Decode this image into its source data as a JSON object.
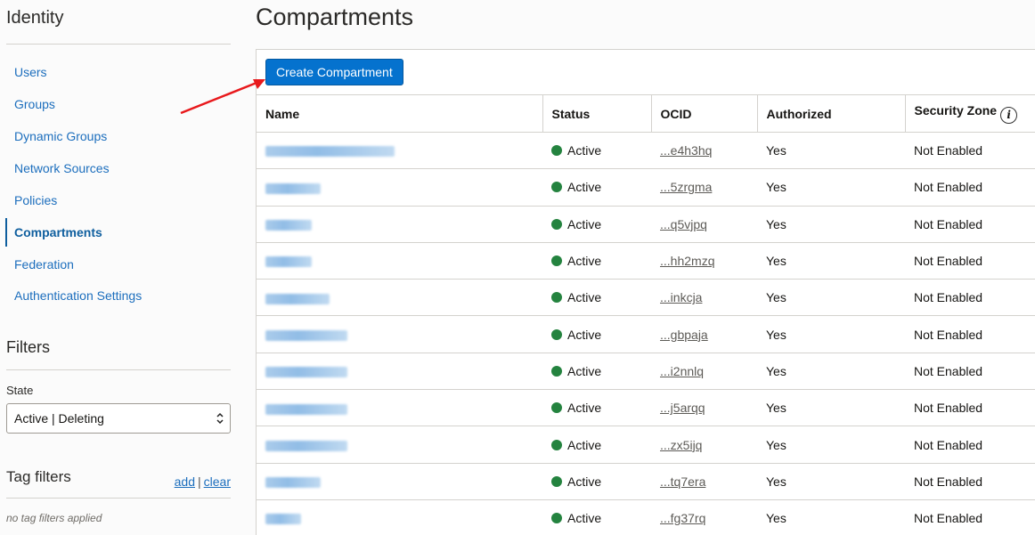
{
  "sidebar": {
    "title": "Identity",
    "nav": [
      {
        "label": "Users"
      },
      {
        "label": "Groups"
      },
      {
        "label": "Dynamic Groups"
      },
      {
        "label": "Network Sources"
      },
      {
        "label": "Policies"
      },
      {
        "label": "Compartments",
        "active": true
      },
      {
        "label": "Federation"
      },
      {
        "label": "Authentication Settings"
      }
    ],
    "filters_title": "Filters",
    "state_label": "State",
    "state_value": "Active | Deleting",
    "tag_filters_title": "Tag filters",
    "tag_add": "add",
    "tag_sep": "|",
    "tag_clear": "clear",
    "no_tag_filters": "no tag filters applied"
  },
  "main": {
    "title": "Compartments",
    "create_button": "Create Compartment",
    "columns": [
      "Name",
      "Status",
      "OCID",
      "Authorized",
      "Security Zone"
    ],
    "rows": [
      {
        "status": "Active",
        "ocid": "...e4h3hq",
        "authorized": "Yes",
        "security_zone": "Not Enabled"
      },
      {
        "status": "Active",
        "ocid": "...5zrgma",
        "authorized": "Yes",
        "security_zone": "Not Enabled"
      },
      {
        "status": "Active",
        "ocid": "...q5vjpq",
        "authorized": "Yes",
        "security_zone": "Not Enabled"
      },
      {
        "status": "Active",
        "ocid": "...hh2mzq",
        "authorized": "Yes",
        "security_zone": "Not Enabled"
      },
      {
        "status": "Active",
        "ocid": "...inkcja",
        "authorized": "Yes",
        "security_zone": "Not Enabled"
      },
      {
        "status": "Active",
        "ocid": "...gbpaja",
        "authorized": "Yes",
        "security_zone": "Not Enabled"
      },
      {
        "status": "Active",
        "ocid": "...i2nnlq",
        "authorized": "Yes",
        "security_zone": "Not Enabled"
      },
      {
        "status": "Active",
        "ocid": "...j5arqq",
        "authorized": "Yes",
        "security_zone": "Not Enabled"
      },
      {
        "status": "Active",
        "ocid": "...zx5ijq",
        "authorized": "Yes",
        "security_zone": "Not Enabled"
      },
      {
        "status": "Active",
        "ocid": "...tq7era",
        "authorized": "Yes",
        "security_zone": "Not Enabled"
      },
      {
        "status": "Active",
        "ocid": "...fg37rq",
        "authorized": "Yes",
        "security_zone": "Not Enabled"
      }
    ]
  },
  "colors": {
    "accent": "#0572ce",
    "link": "#1c6ebd",
    "status_active": "#24833f",
    "annotation_arrow": "#e8191c"
  },
  "icons": {
    "info": "info-icon",
    "select_chevrons": "chevron-up-down-icon",
    "status_dot": "status-dot-icon"
  }
}
